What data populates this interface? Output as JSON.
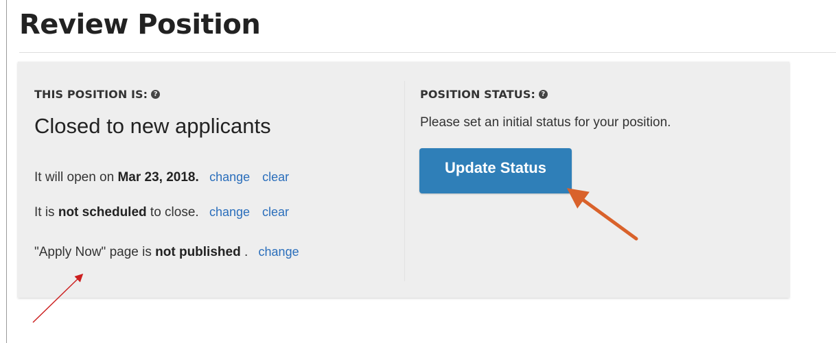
{
  "page": {
    "title": "Review Position"
  },
  "availability": {
    "heading": "THIS POSITION IS:",
    "status": "Closed to new applicants",
    "open_line": {
      "prefix": "It will open on ",
      "date": "Mar 23, 2018.",
      "change_label": "change",
      "clear_label": "clear"
    },
    "close_line": {
      "prefix": "It is ",
      "emphasis": "not scheduled",
      "suffix": " to close.",
      "change_label": "change",
      "clear_label": "clear"
    },
    "apply_line": {
      "prefix": "\"Apply Now\" page is ",
      "emphasis": "not published",
      "suffix": " .",
      "change_label": "change"
    }
  },
  "position_status": {
    "heading": "POSITION STATUS:",
    "hint": "Please set an initial status for your position.",
    "button_label": "Update Status"
  },
  "colors": {
    "link": "#2a6ebb",
    "button": "#2f7fb8",
    "panel": "#eeeeee",
    "orange_arrow": "#d9622b",
    "red_arrow": "#cc1f1f"
  },
  "icons": {
    "help": "question-circle-icon",
    "annotation_arrow": "arrow-icon"
  }
}
